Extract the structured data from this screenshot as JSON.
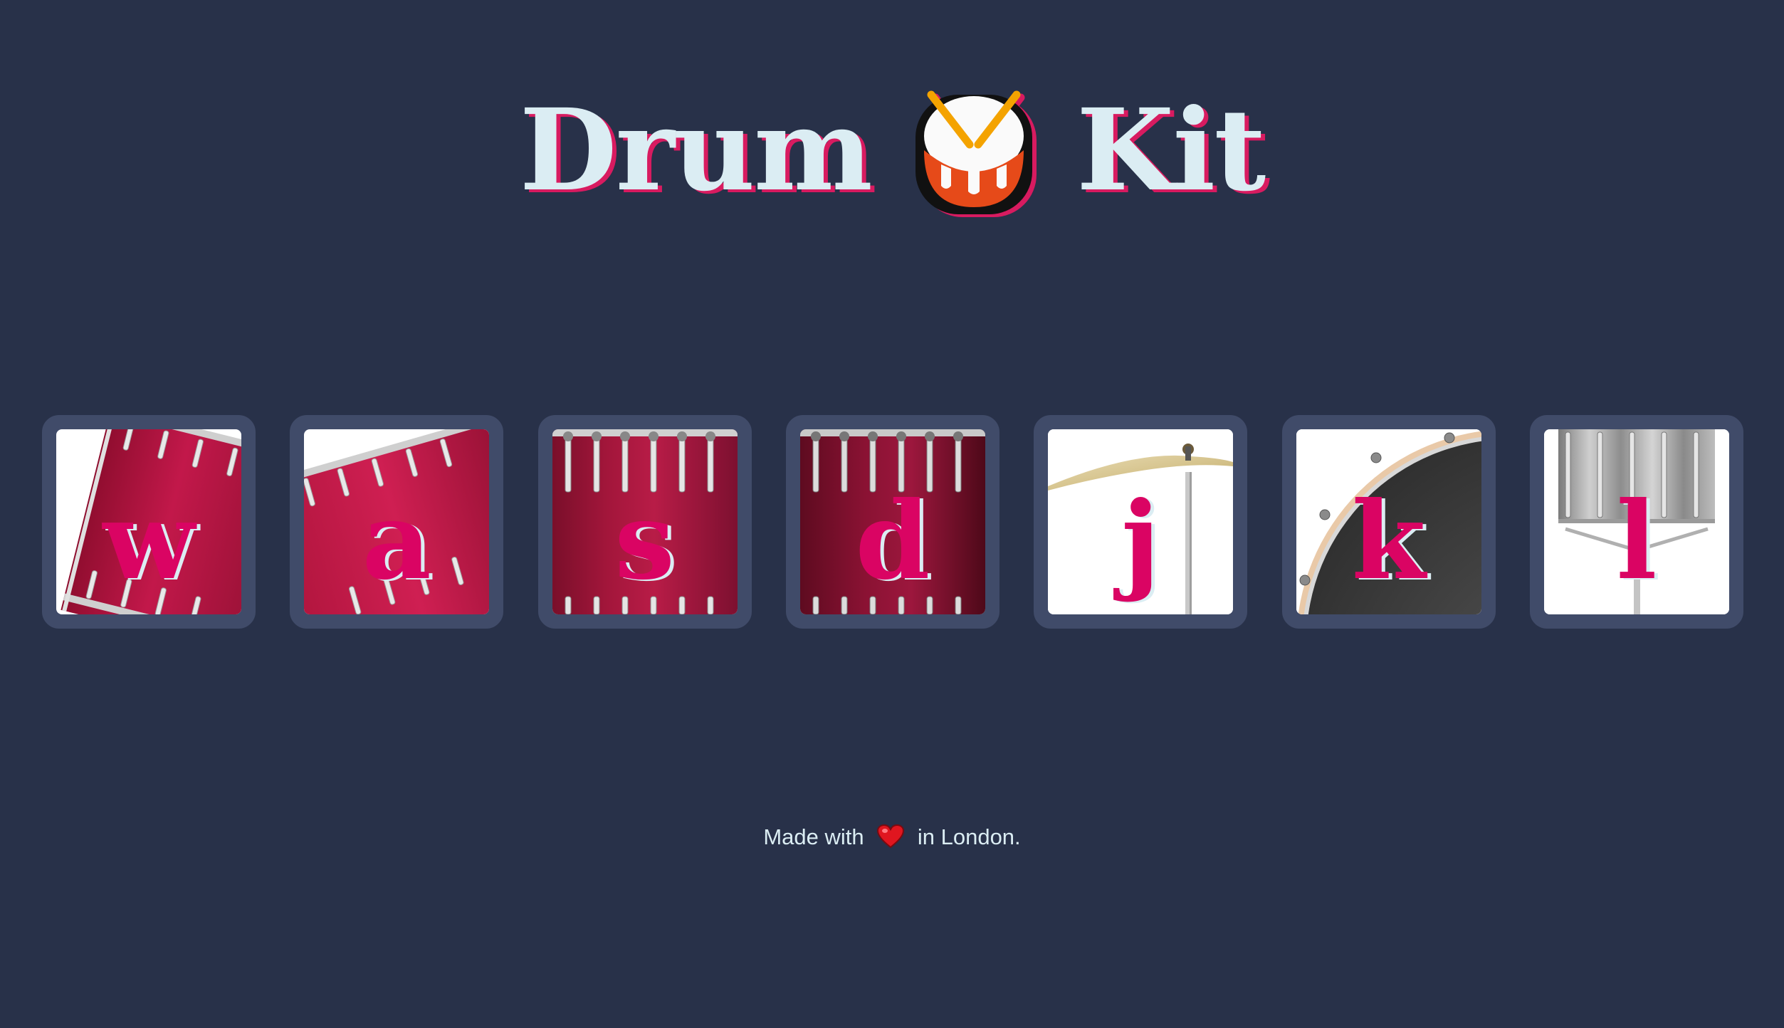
{
  "header": {
    "title_left": "Drum",
    "title_right": "Kit",
    "title_icon": "drum-emoji-icon"
  },
  "keys": [
    {
      "letter": "w",
      "instrument_icon": "tom-drum-icon"
    },
    {
      "letter": "a",
      "instrument_icon": "tom-drum-icon"
    },
    {
      "letter": "s",
      "instrument_icon": "floor-tom-icon"
    },
    {
      "letter": "d",
      "instrument_icon": "floor-tom-icon"
    },
    {
      "letter": "j",
      "instrument_icon": "cymbal-icon"
    },
    {
      "letter": "k",
      "instrument_icon": "bass-drum-icon"
    },
    {
      "letter": "l",
      "instrument_icon": "snare-drum-icon"
    }
  ],
  "footer": {
    "prefix": "Made with",
    "heart_icon": "heart-icon",
    "suffix": "in London."
  },
  "colors": {
    "background": "#283149",
    "key_frame": "#404b69",
    "letter": "#da0463",
    "title_text": "#dbedf3",
    "title_shadow": "#d81b60"
  }
}
